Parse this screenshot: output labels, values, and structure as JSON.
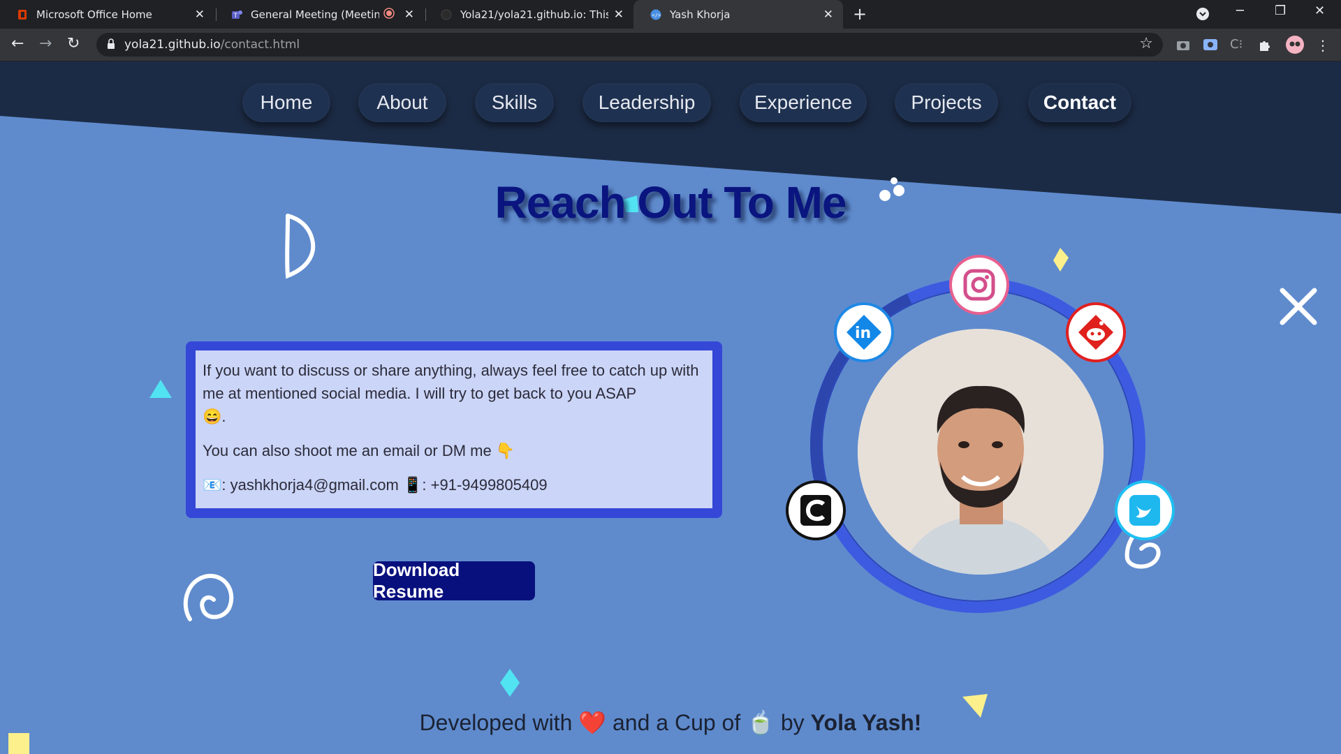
{
  "browser": {
    "tabs": [
      {
        "title": "Microsoft Office Home",
        "icon": "office-icon",
        "active": false
      },
      {
        "title": "General Meeting (Meeting) |",
        "icon": "teams-icon",
        "active": false
      },
      {
        "title": "Yola21/yola21.github.io: This is m",
        "icon": "github-icon",
        "active": false
      },
      {
        "title": "Yash Khorja",
        "icon": "code-icon",
        "active": true
      }
    ],
    "url_domain": "yola21.github.io",
    "url_path": "/contact.html"
  },
  "nav": {
    "items": [
      "Home",
      "About",
      "Skills",
      "Leadership",
      "Experience",
      "Projects",
      "Contact"
    ],
    "active": "Contact"
  },
  "heading": "Reach Out To Me",
  "message": {
    "line1": "If you want to discuss or share anything, always feel free to catch up with me at mentioned social media. I will try to get back to you ASAP",
    "line1_emoji": "😄",
    "line1_end": ".",
    "line2": "You can also shoot me an email or DM me",
    "line2_emoji": "👇",
    "email_icon": "📧",
    "email": ": yashkhorja4@gmail.com",
    "phone_icon": "📱",
    "phone": ": +91-9499805409"
  },
  "resume_button": "Download Resume",
  "social": [
    "instagram-icon",
    "linkedin-icon",
    "reddit-icon",
    "codechef-icon",
    "twitter-icon"
  ],
  "footer": {
    "prefix": "Developed with",
    "heart": "❤️",
    "middle": "and a Cup of",
    "cup": "🍵",
    "by": "by",
    "name": "Yola Yash!"
  },
  "colors": {
    "page_bg": "#5f8bcd",
    "dark_bg": "#1c2b45",
    "heading": "#0a157f",
    "box_border": "#3547d6",
    "box_fill": "#cbd5f7",
    "button": "#08107d",
    "ring": "#3d5be0"
  }
}
